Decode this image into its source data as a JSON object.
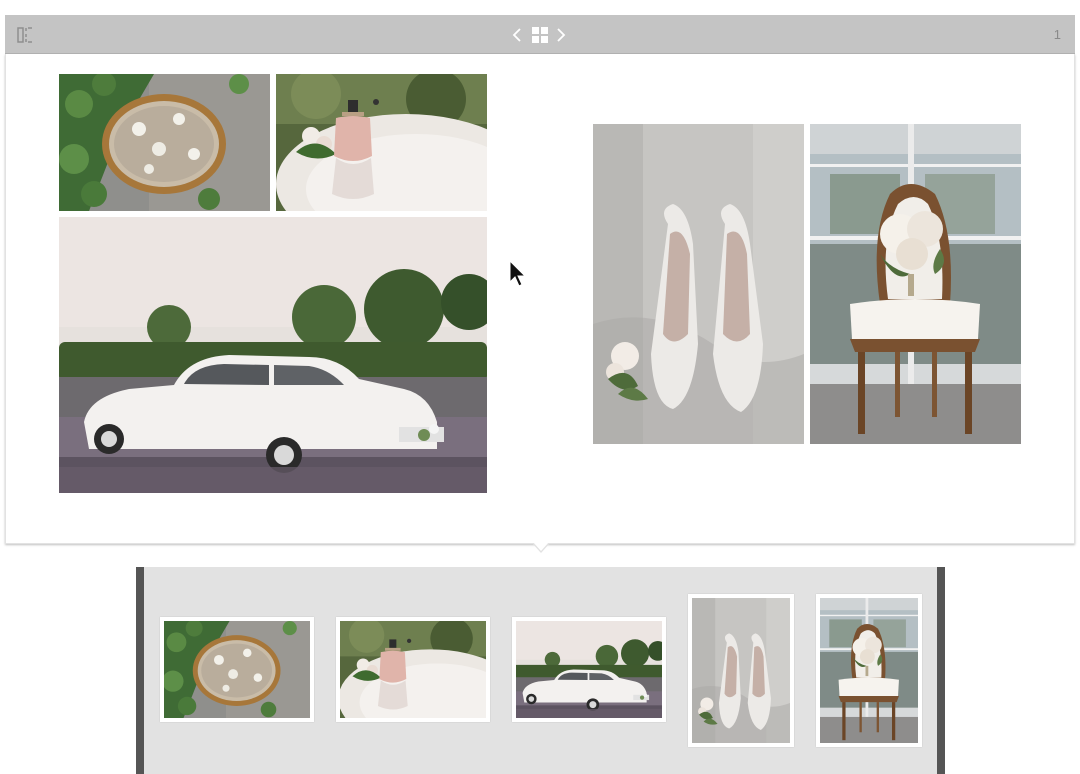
{
  "toolbar": {
    "page_number": "1",
    "icons": {
      "panel_toggle": "panel-toggle-icon",
      "prev": "chevron-left-icon",
      "grid": "grid-icon",
      "next": "chevron-right-icon"
    }
  },
  "spread": {
    "left_page_photos": [
      "tray",
      "perfume",
      "car"
    ],
    "right_page_photos": [
      "shoes",
      "chair"
    ]
  },
  "filmstrip": {
    "thumbnails": [
      "tray",
      "perfume",
      "car",
      "shoes",
      "chair"
    ]
  },
  "colors": {
    "toolbar_bg": "#c4c4c4",
    "filmstrip_bg": "#e2e2e2",
    "filmstrip_edge": "#555555"
  }
}
